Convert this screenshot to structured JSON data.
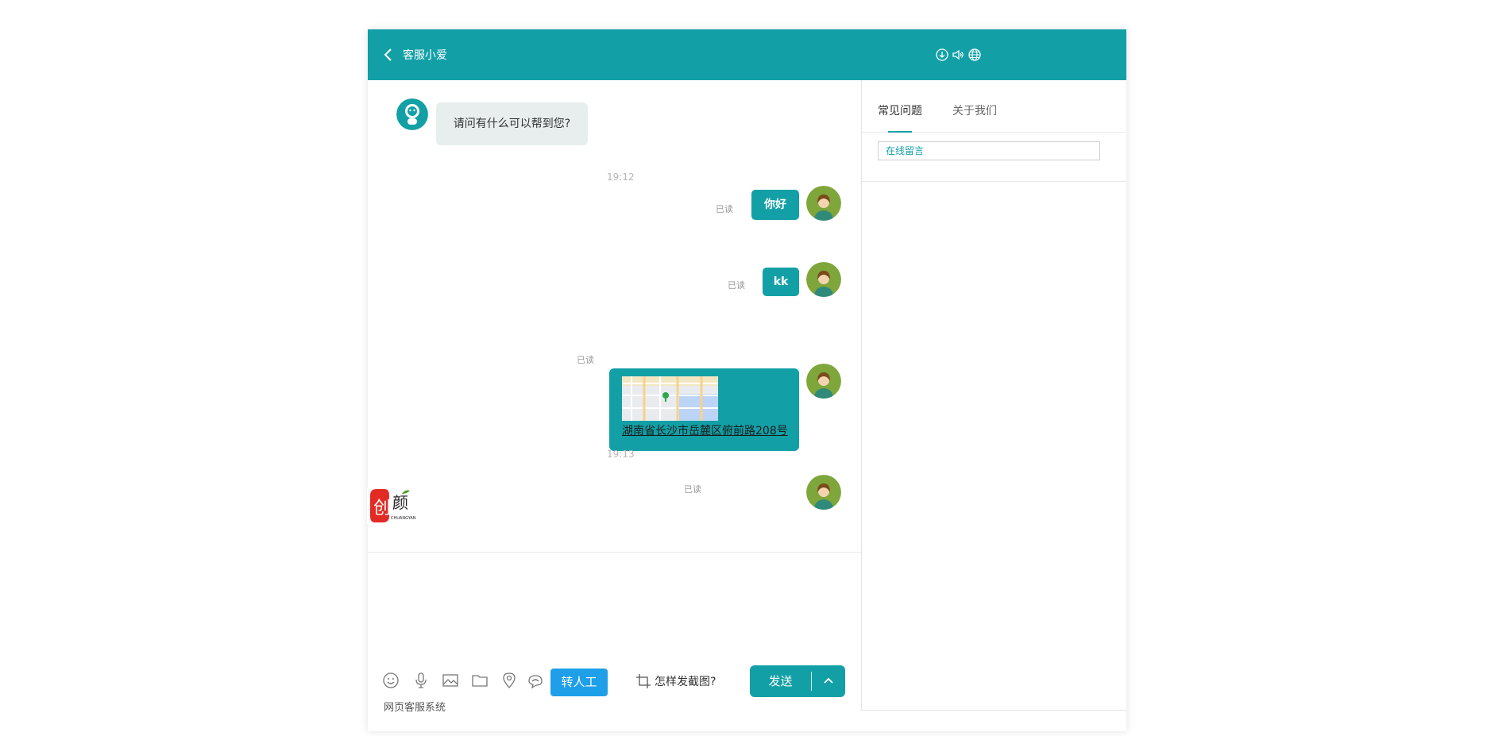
{
  "colors": {
    "accent": "#12a0a6",
    "transfer": "#1e9fe8"
  },
  "header": {
    "title": "客服小爱",
    "icons": [
      "download-icon",
      "speaker-icon",
      "globe-icon"
    ]
  },
  "messages": {
    "bot_greeting": "请问有什么可以帮到您?",
    "time1": "19:12",
    "msg1": {
      "text": "你好",
      "status": "已读"
    },
    "msg2": {
      "text": "kk",
      "status": "已读"
    },
    "msg3": {
      "address": "湖南省长沙市岳麓区俯前路208号",
      "status": "已读"
    },
    "time2": "19:13",
    "msg4": {
      "status": "已读",
      "image": "chuangyan-logo"
    }
  },
  "toolbar": {
    "icons": [
      "emoji-icon",
      "microphone-icon",
      "image-icon",
      "folder-icon",
      "location-icon",
      "evaluate-icon"
    ],
    "transfer_label": "转人工",
    "screenshot_help": "怎样发截图?",
    "send_label": "发送"
  },
  "footer": {
    "text": "网页客服系统"
  },
  "side": {
    "tabs": [
      {
        "label": "常见问题",
        "active": true
      },
      {
        "label": "关于我们",
        "active": false
      }
    ],
    "leave_message": "在线留言"
  }
}
